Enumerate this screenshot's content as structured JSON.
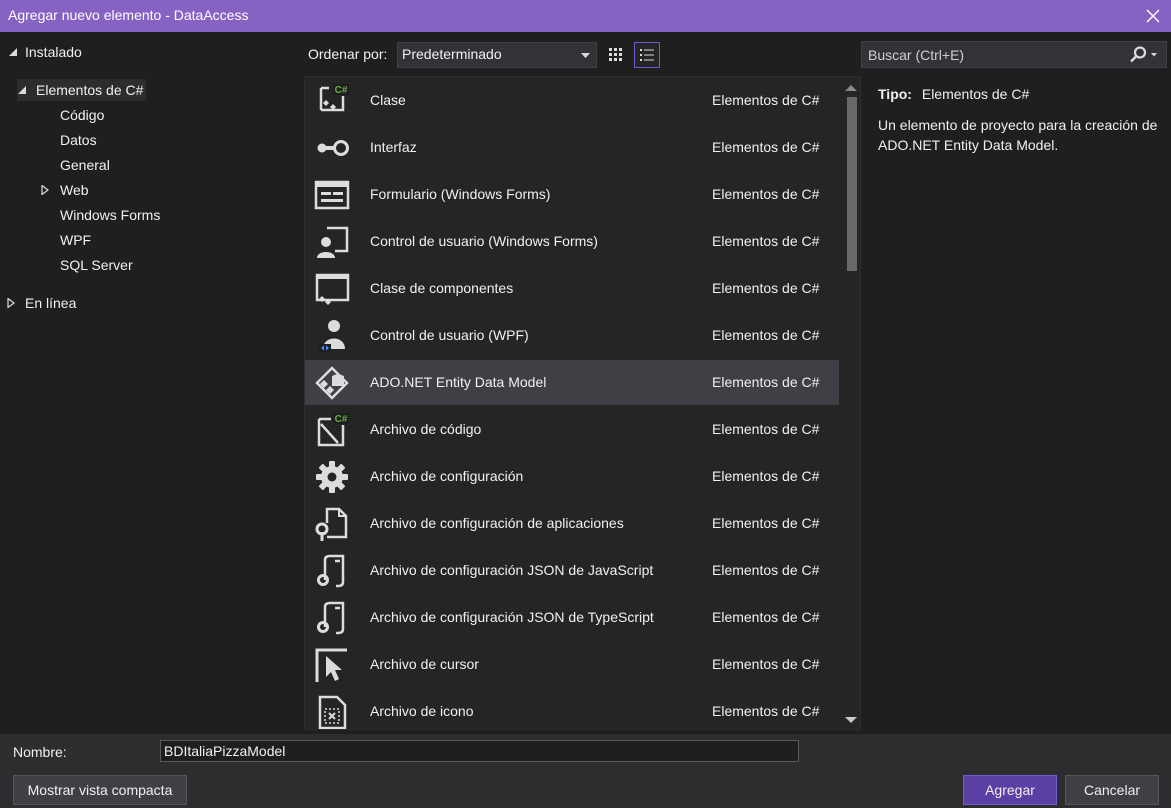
{
  "window": {
    "title": "Agregar nuevo elemento - DataAccess"
  },
  "tree": {
    "installed": "Instalado",
    "csharp_items": "Elementos de C#",
    "children": [
      "Código",
      "Datos",
      "General",
      "Web",
      "Windows Forms",
      "WPF",
      "SQL Server"
    ],
    "online": "En línea"
  },
  "toolbar": {
    "sort_label": "Ordenar por:",
    "sort_value": "Predeterminado"
  },
  "list": {
    "selected_index": 6,
    "items": [
      {
        "name": "Clase",
        "category": "Elementos de C#",
        "icon": "class-icon"
      },
      {
        "name": "Interfaz",
        "category": "Elementos de C#",
        "icon": "interface-icon"
      },
      {
        "name": "Formulario (Windows Forms)",
        "category": "Elementos de C#",
        "icon": "windows-form-icon"
      },
      {
        "name": "Control de usuario (Windows Forms)",
        "category": "Elementos de C#",
        "icon": "user-control-icon"
      },
      {
        "name": "Clase de componentes",
        "category": "Elementos de C#",
        "icon": "component-class-icon"
      },
      {
        "name": "Control de usuario (WPF)",
        "category": "Elementos de C#",
        "icon": "wpf-user-control-icon"
      },
      {
        "name": "ADO.NET Entity Data Model",
        "category": "Elementos de C#",
        "icon": "entity-data-model-icon"
      },
      {
        "name": "Archivo de código",
        "category": "Elementos de C#",
        "icon": "code-file-icon"
      },
      {
        "name": "Archivo de configuración",
        "category": "Elementos de C#",
        "icon": "settings-gear-icon"
      },
      {
        "name": "Archivo de configuración de aplicaciones",
        "category": "Elementos de C#",
        "icon": "app-config-icon"
      },
      {
        "name": "Archivo de configuración JSON de JavaScript",
        "category": "Elementos de C#",
        "icon": "json-config-icon"
      },
      {
        "name": "Archivo de configuración JSON de TypeScript",
        "category": "Elementos de C#",
        "icon": "json-config-icon"
      },
      {
        "name": "Archivo de cursor",
        "category": "Elementos de C#",
        "icon": "cursor-file-icon"
      },
      {
        "name": "Archivo de icono",
        "category": "Elementos de C#",
        "icon": "icon-file-icon"
      }
    ]
  },
  "search": {
    "placeholder": "Buscar (Ctrl+E)"
  },
  "details": {
    "type_label": "Tipo:",
    "type_value": "Elementos de C#",
    "description": "Un elemento de proyecto para la creación de ADO.NET Entity Data Model."
  },
  "bottom": {
    "name_label": "Nombre:",
    "name_value": "BDItaliaPizzaModel",
    "compact_label": "Mostrar vista compacta",
    "add_label": "Agregar",
    "cancel_label": "Cancelar"
  },
  "colors": {
    "titlebar": "#8662c2",
    "accent": "#6e5bd0",
    "selection": "#3f3f46",
    "csharp_badge": "#6ab04c"
  }
}
